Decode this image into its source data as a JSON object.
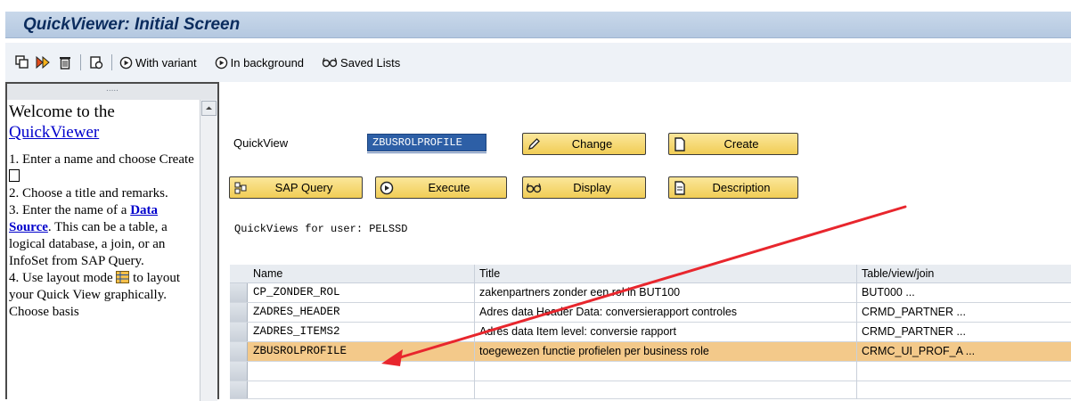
{
  "window": {
    "title": "QuickViewer: Initial Screen"
  },
  "toolbar": {
    "with_variant": "With variant",
    "in_background": "In background",
    "saved_lists": "Saved Lists"
  },
  "help": {
    "welcome": "Welcome to the",
    "link_quickviewer": "QuickViewer",
    "step1": "1. Enter a name and choose Create",
    "step2": "2. Choose a title and remarks.",
    "step3_pre": "3. Enter the name of a",
    "step3_link": "Data Source",
    "step3_post": ". This can be a table, a logical database, a join, or an InfoSet from SAP Query.",
    "step4_pre": "4. Use layout mode",
    "step4_post": "to layout your Quick View graphically. Choose basis",
    "grip": ".....",
    "icons": [
      "create-page-icon",
      "layout-grid-icon"
    ]
  },
  "form": {
    "quickview_label": "QuickView",
    "quickview_value": "ZBUSROLPROFILE",
    "change_label": "Change",
    "create_label": "Create",
    "sap_query_label": "SAP Query",
    "execute_label": "Execute",
    "display_label": "Display",
    "description_label": "Description",
    "user_info": "QuickViews for user: PELSSD"
  },
  "table": {
    "columns": [
      "Name",
      "Title",
      "Table/view/join"
    ],
    "rows": [
      {
        "name": "CP_ZONDER_ROL",
        "title": "zakenpartners zonder een rol in BUT100",
        "source": "BUT000 ..."
      },
      {
        "name": "ZADRES_HEADER",
        "title": "Adres data Header Data: conversierapport controles",
        "source": "CRMD_PARTNER ..."
      },
      {
        "name": "ZADRES_ITEMS2",
        "title": "Adres data Item level: conversie rapport",
        "source": "CRMD_PARTNER ..."
      },
      {
        "name": "ZBUSROLPROFILE",
        "title": "toegewezen functie profielen per business role",
        "source": "CRMC_UI_PROF_A ..."
      }
    ],
    "selected_row": 3
  },
  "colors": {
    "accent_arrow": "#e8262d",
    "button_yellow": "#f5d66a",
    "selected_row": "#f3c98a",
    "field_blue": "#2d5fa6",
    "title_blue": "#0b2c5e"
  }
}
